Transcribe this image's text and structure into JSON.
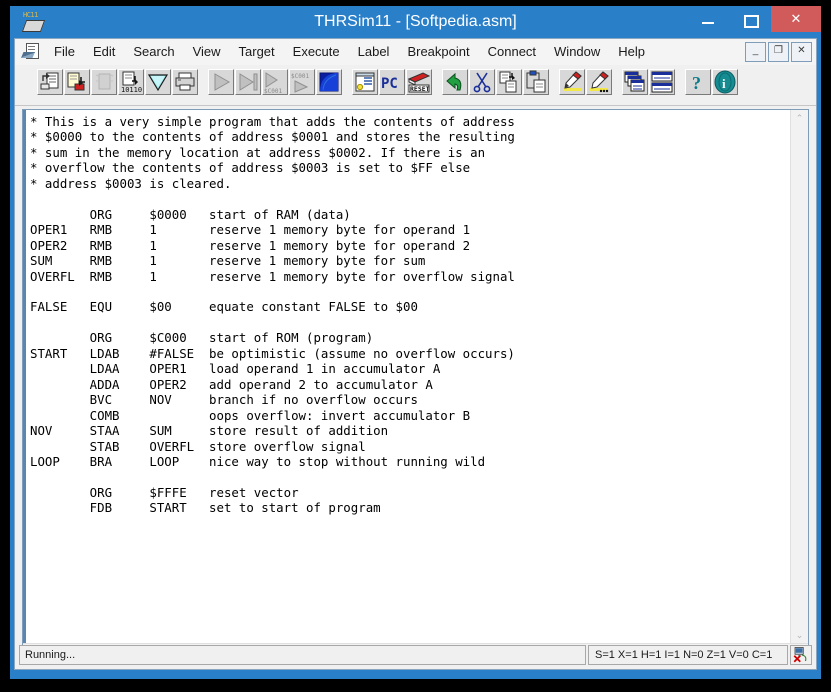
{
  "window": {
    "title": "THRSim11 - [Softpedia.asm]",
    "app_icon": "hc11-chip-icon",
    "chip_label": "HC11",
    "controls": {
      "minimize": "minimize-icon",
      "maximize": "maximize-icon",
      "close": "✕"
    }
  },
  "menubar": {
    "doc_icon": "mdi-document-icon",
    "items": [
      "File",
      "Edit",
      "Search",
      "View",
      "Target",
      "Execute",
      "Label",
      "Breakpoint",
      "Connect",
      "Window",
      "Help"
    ],
    "mdi_controls": {
      "minimize": "_",
      "restore": "❐",
      "close": "✕"
    }
  },
  "toolbar": {
    "buttons": [
      {
        "name": "open-file-button",
        "icon": "open-file-icon"
      },
      {
        "name": "save-file-button",
        "icon": "save-file-icon"
      },
      {
        "name": "assemble-button",
        "icon": "assemble-icon",
        "disabled": true
      },
      {
        "name": "load-object-button",
        "icon": "load-binary-icon"
      },
      {
        "name": "filter-button",
        "icon": "funnel-icon"
      },
      {
        "name": "print-button",
        "icon": "printer-icon"
      },
      {
        "name": "run-button",
        "icon": "play-icon",
        "disabled": true
      },
      {
        "name": "step-button",
        "icon": "step-over-icon",
        "disabled": true
      },
      {
        "name": "run-to-cursor-button",
        "icon": "run-to-address-icon",
        "disabled": true
      },
      {
        "name": "stop-button",
        "icon": "stop-blue-icon"
      },
      {
        "name": "registers-window-button",
        "icon": "register-window-icon"
      },
      {
        "name": "program-counter-button",
        "icon": "pc-icon"
      },
      {
        "name": "reset-button",
        "icon": "reset-icon"
      },
      {
        "name": "undo-button",
        "icon": "undo-arrow-icon"
      },
      {
        "name": "cut-button",
        "icon": "scissors-icon"
      },
      {
        "name": "copy-button",
        "icon": "copy-icon"
      },
      {
        "name": "paste-button",
        "icon": "paste-icon"
      },
      {
        "name": "marker-button",
        "icon": "highlighter-icon"
      },
      {
        "name": "marker-options-button",
        "icon": "highlighter-dots-icon"
      },
      {
        "name": "cascade-windows-button",
        "icon": "cascade-windows-icon"
      },
      {
        "name": "tile-windows-button",
        "icon": "tile-windows-icon"
      },
      {
        "name": "help-button",
        "icon": "question-mark-icon"
      },
      {
        "name": "about-button",
        "icon": "about-info-icon"
      }
    ]
  },
  "editor": {
    "filename": "Softpedia.asm",
    "source": "* This is a very simple program that adds the contents of address\n* $0000 to the contents of address $0001 and stores the resulting\n* sum in the memory location at address $0002. If there is an\n* overflow the contents of address $0003 is set to $FF else\n* address $0003 is cleared.\n\n        ORG     $0000   start of RAM (data)\nOPER1   RMB     1       reserve 1 memory byte for operand 1\nOPER2   RMB     1       reserve 1 memory byte for operand 2\nSUM     RMB     1       reserve 1 memory byte for sum\nOVERFL  RMB     1       reserve 1 memory byte for overflow signal\n\nFALSE   EQU     $00     equate constant FALSE to $00\n\n        ORG     $C000   start of ROM (program)\nSTART   LDAB    #FALSE  be optimistic (assume no overflow occurs)\n        LDAA    OPER1   load operand 1 in accumulator A\n        ADDA    OPER2   add operand 2 to accumulator A\n        BVC     NOV     branch if no overflow occurs\n        COMB            oops overflow: invert accumulator B\nNOV     STAA    SUM     store result of addition\n        STAB    OVERFL  store overflow signal\nLOOP    BRA     LOOP    nice way to stop without running wild\n\n        ORG     $FFFE   reset vector\n        FDB     START   set to start of program",
    "scrollbars": {
      "v_up": "⌃",
      "v_down": "⌄",
      "h_left": "❮",
      "h_right": "❯"
    }
  },
  "statusbar": {
    "message": "Running...",
    "flags": "S=1 X=1 H=1 I=1 N=0 Z=1 V=0 C=1",
    "icon": "connection-disconnected-icon"
  },
  "colors": {
    "frame_blue": "#2a7fc9",
    "close_red": "#d15b5b",
    "client_grey": "#f0f0f0",
    "editor_white": "#ffffff",
    "gutter_blue": "#5a87b0"
  }
}
